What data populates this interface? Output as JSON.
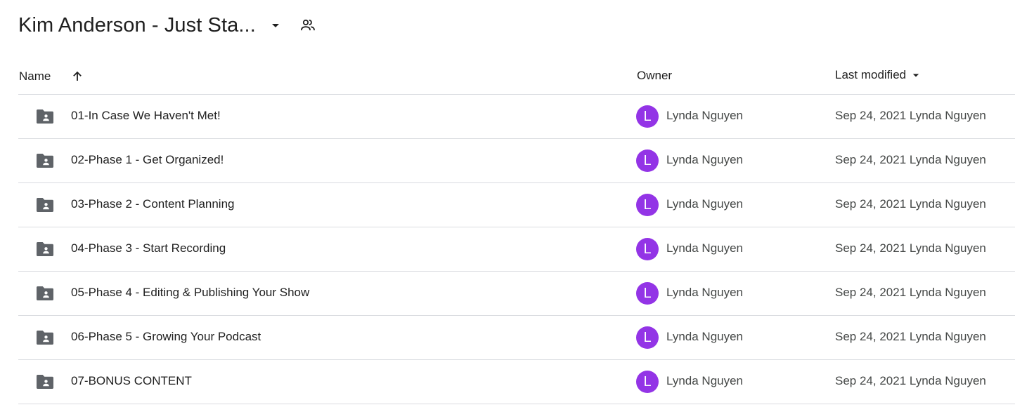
{
  "header": {
    "folder_title": "Kim Anderson - Just Sta...",
    "dropdown_icon": "arrow-drop-down-icon",
    "share_icon": "shared-people-icon"
  },
  "columns": {
    "name": "Name",
    "owner": "Owner",
    "last_modified": "Last modified",
    "name_sort_icon": "arrow-upward-icon",
    "modified_sort_icon": "arrow-drop-down-icon"
  },
  "colors": {
    "avatar_bg": "#9334e6",
    "icon_gray": "#5f6368",
    "divider": "#dadce0"
  },
  "files": [
    {
      "name": "01-In Case We Haven't Met!",
      "icon": "shared-folder-icon",
      "owner_initial": "L",
      "owner": "Lynda Nguyen",
      "modified": "Sep 24, 2021 Lynda Nguyen"
    },
    {
      "name": "02-Phase 1 - Get Organized!",
      "icon": "shared-folder-icon",
      "owner_initial": "L",
      "owner": "Lynda Nguyen",
      "modified": "Sep 24, 2021 Lynda Nguyen"
    },
    {
      "name": "03-Phase 2 - Content Planning",
      "icon": "shared-folder-icon",
      "owner_initial": "L",
      "owner": "Lynda Nguyen",
      "modified": "Sep 24, 2021 Lynda Nguyen"
    },
    {
      "name": "04-Phase 3 - Start Recording",
      "icon": "shared-folder-icon",
      "owner_initial": "L",
      "owner": "Lynda Nguyen",
      "modified": "Sep 24, 2021 Lynda Nguyen"
    },
    {
      "name": "05-Phase 4 - Editing & Publishing Your Show",
      "icon": "shared-folder-icon",
      "owner_initial": "L",
      "owner": "Lynda Nguyen",
      "modified": "Sep 24, 2021 Lynda Nguyen"
    },
    {
      "name": "06-Phase 5 - Growing Your Podcast",
      "icon": "shared-folder-icon",
      "owner_initial": "L",
      "owner": "Lynda Nguyen",
      "modified": "Sep 24, 2021 Lynda Nguyen"
    },
    {
      "name": "07-BONUS CONTENT",
      "icon": "shared-folder-icon",
      "owner_initial": "L",
      "owner": "Lynda Nguyen",
      "modified": "Sep 24, 2021 Lynda Nguyen"
    }
  ]
}
